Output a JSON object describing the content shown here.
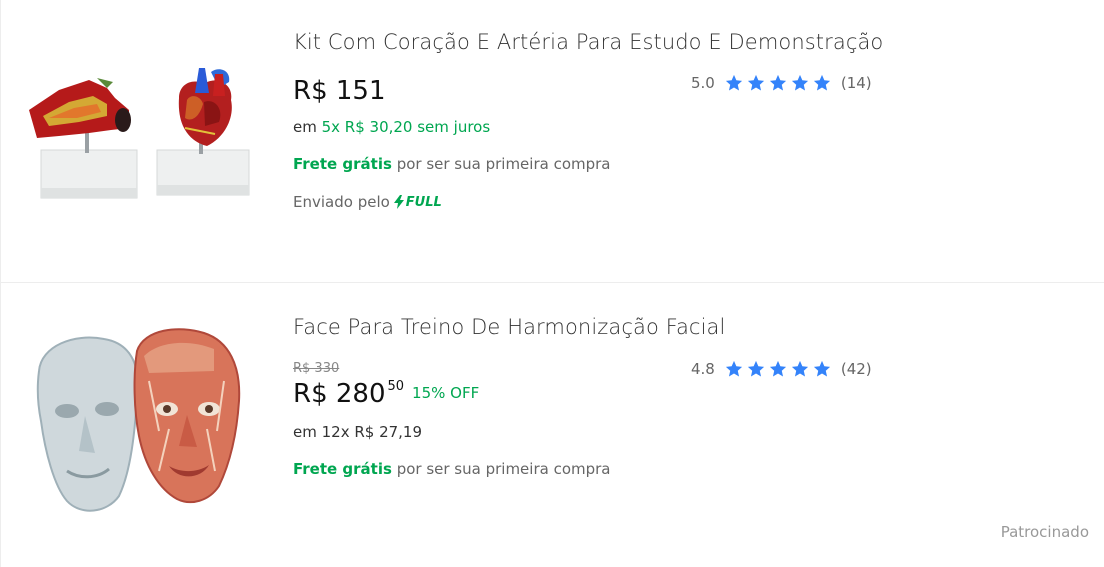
{
  "colors": {
    "green": "#00a650",
    "star": "#3483fa",
    "text": "#333333",
    "muted": "#666666"
  },
  "items": [
    {
      "title": "Kit Com Coração E Artéria Para Estudo E Demonstração",
      "image_icon": "heart-artery-model-image",
      "price": "R$ 151",
      "install_prefix": "em ",
      "install_value": "5x R$ 30,20 sem juros",
      "ship_free": "Frete grátis",
      "ship_rest": " por ser sua primeira compra",
      "full_prefix": "Enviado pelo",
      "full_badge": "FULL",
      "rating_value": "5.0",
      "rating_count": "(14)",
      "stars": 5
    },
    {
      "title": "Face Para Treino De Harmonização Facial",
      "image_icon": "face-model-image",
      "old_price": "R$ 330",
      "price": "R$ 280",
      "price_cents": "50",
      "off": "15% OFF",
      "install": "em 12x R$ 27,19",
      "ship_free": "Frete grátis",
      "ship_rest": " por ser sua primeira compra",
      "rating_value": "4.8",
      "rating_count": "(42)",
      "stars": 4.8
    }
  ],
  "sponsored": "Patrocinado"
}
